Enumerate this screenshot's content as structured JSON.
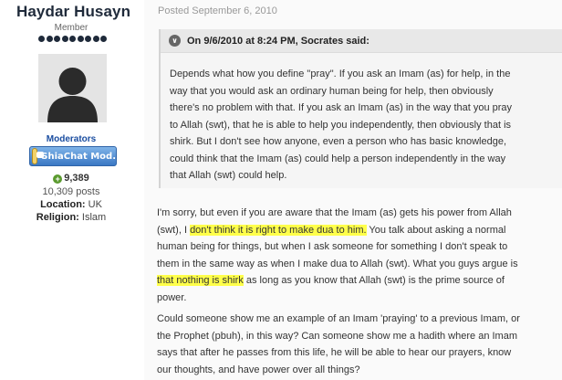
{
  "author": {
    "name": "Haydar Husayn",
    "title": "Member",
    "group": "Moderators",
    "badge_text": "ShiaChat Mod.",
    "reputation": "9,389",
    "posts": "10,309 posts",
    "location_label": "Location:",
    "location_value": "UK",
    "religion_label": "Religion:",
    "religion_value": "Islam",
    "pip_count": 9
  },
  "post": {
    "date": "Posted September 6, 2010",
    "quote_header": "On 9/6/2010 at 8:24 PM, Socrates said:",
    "quote_lines": [
      "Depends what how you define \"pray\". If you ask an Imam (as) for help, in the",
      "way that you would ask an ordinary human being for help, then obviously",
      "there's no problem with that. If you ask an Imam (as) in the way that you pray",
      "to Allah (swt), that he is able to help you independently, then obviously that is",
      "shirk. But I don't see how anyone, even a person who has basic knowledge,",
      "could think that the Imam (as) could help a person independently in the way",
      "that Allah (swt) could help."
    ],
    "para1": {
      "l1": "I'm sorry, but even if you are aware that the Imam (as) gets his power from Allah",
      "l2_pre": "(swt), I ",
      "l2_hl": "don't think it is right to make dua to him.",
      "l2_post": " You talk about asking a normal",
      "l3": "human being for things, but when I ask someone for something I don't speak to",
      "l4": "them in the same way as when I make dua to Allah (swt). What you guys argue is",
      "l5_hl": "that nothing is shirk",
      "l5_post": " as long as you know that Allah (swt) is the prime source of",
      "l6": "power."
    },
    "para2_lines": [
      "Could someone show me an example of an Imam 'praying' to a previous Imam, or",
      "the Prophet (pbuh), in this way? Can someone show me a hadith where an Imam",
      "says that after he passes from this life, he will be able to hear our prayers, know",
      "our thoughts, and have power over all things?"
    ],
    "highlight_color": "#ffff4a"
  }
}
